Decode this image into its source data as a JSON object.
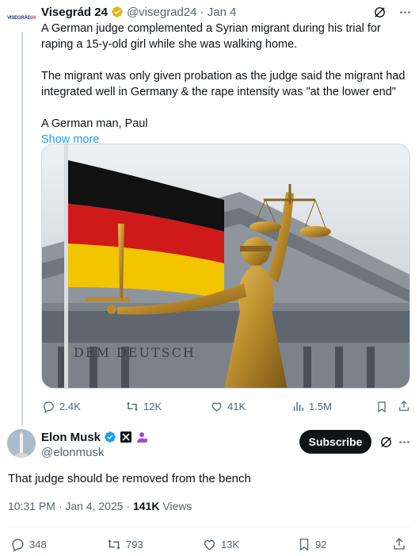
{
  "parent_tweet": {
    "avatar_text_a": "VISEGRÁD",
    "avatar_text_b": "24",
    "name": "Visegrád 24",
    "handle": "@visegrad24",
    "date": "· Jan 4",
    "text_1": "A German judge complemented a Syrian migrant during his trial for raping a 15-y-old girl while she was walking home.",
    "text_2": "The migrant was only given probation as the judge said the migrant had integrated well in Germany & the rape intensity was \"at the lower end\"",
    "text_3": "A German man, Paul",
    "show_more": "Show more",
    "media_text": "DEM DEUTSCH",
    "replies": "2.4K",
    "reposts": "12K",
    "likes": "41K",
    "views": "1.5M"
  },
  "main_tweet": {
    "name": "Elon Musk",
    "handle": "@elonmusk",
    "subscribe_label": "Subscribe",
    "text": "That judge should be removed from the bench",
    "time": "10:31 PM · Jan 4, 2025 · ",
    "views_count": "141K",
    "views_label": " Views",
    "replies": "348",
    "reposts": "793",
    "likes": "13K",
    "bookmarks": "92"
  },
  "colors": {
    "accent": "#1d9bf0",
    "text": "#0f1419",
    "muted": "#536471",
    "gold_badge": "#e2b719"
  },
  "icons": [
    "grok-icon",
    "more-icon",
    "reply-icon",
    "repost-icon",
    "like-icon",
    "views-icon",
    "bookmark-icon",
    "share-icon",
    "verified-badge-icon",
    "x-affiliate-icon",
    "premium-icon"
  ]
}
